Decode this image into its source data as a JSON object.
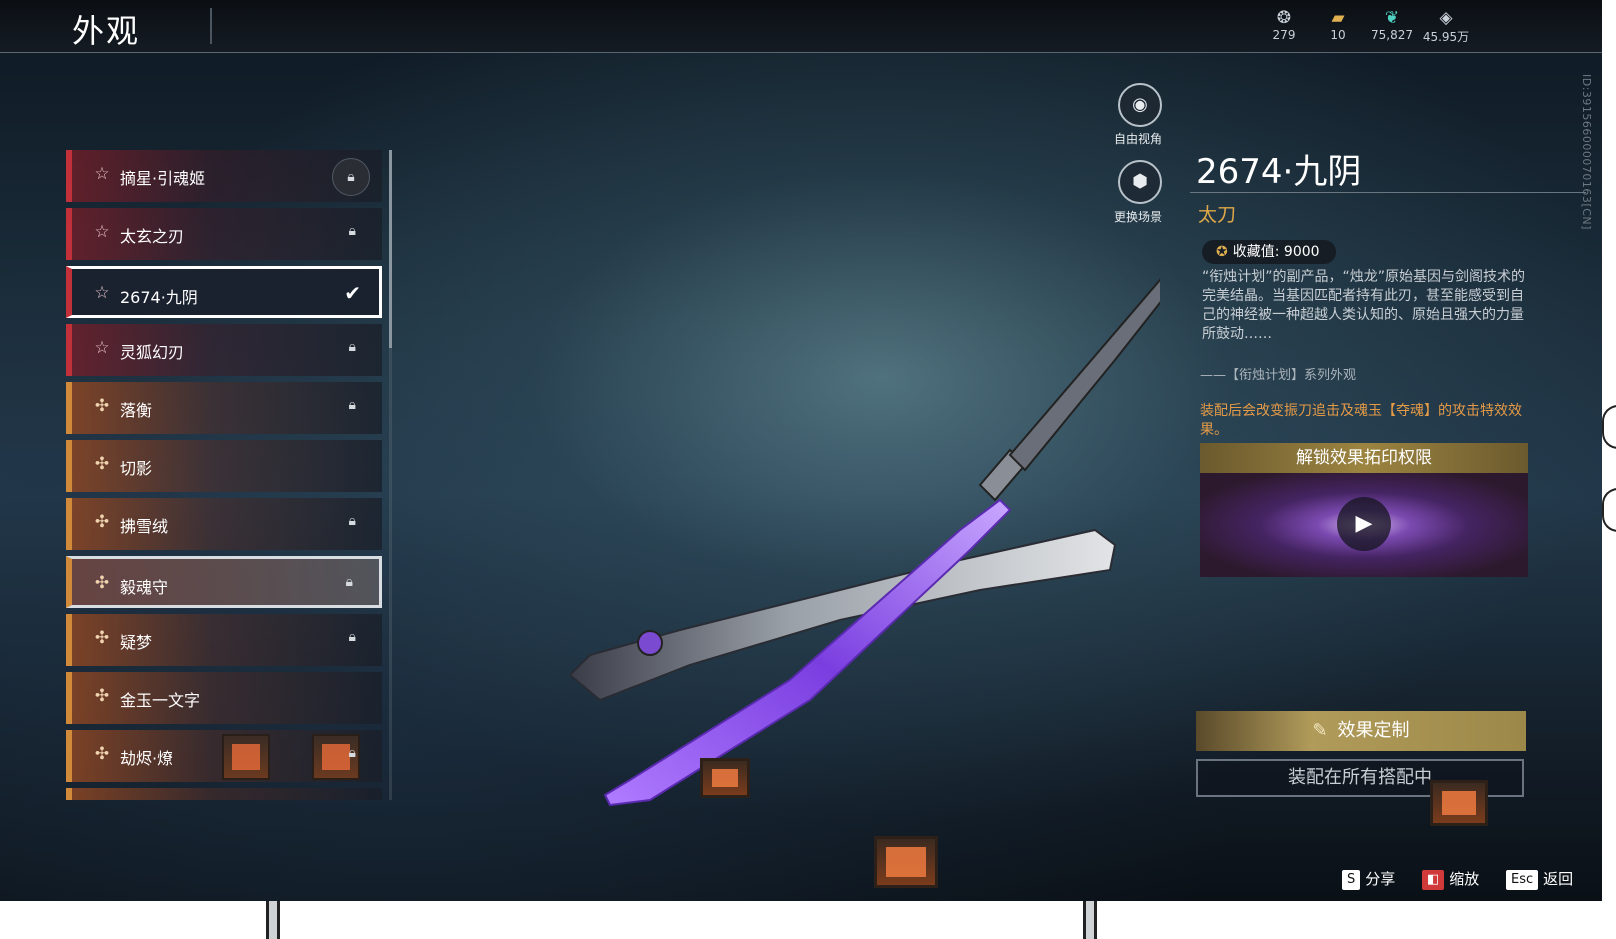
{
  "header": {
    "title": "外观",
    "currencies": [
      {
        "icon": "sprite-icon",
        "value": "279"
      },
      {
        "icon": "ticket-icon",
        "value": "10"
      },
      {
        "icon": "feather-icon",
        "value": "75,827"
      },
      {
        "icon": "diamond-icon",
        "value": "45.95万"
      }
    ]
  },
  "uid": "ID:391566000070163[CN]",
  "list": {
    "items": [
      {
        "name": "摘星·引魂姬",
        "rarity": "red",
        "status": "locked"
      },
      {
        "name": "太玄之刃",
        "rarity": "red",
        "status": "locked"
      },
      {
        "name": "2674·九阴",
        "rarity": "red",
        "status": "equipped"
      },
      {
        "name": "灵狐幻刃",
        "rarity": "red",
        "status": "locked"
      },
      {
        "name": "落衡",
        "rarity": "orange",
        "status": "locked"
      },
      {
        "name": "切影",
        "rarity": "orange",
        "status": "none"
      },
      {
        "name": "拂雪绒",
        "rarity": "orange",
        "status": "locked"
      },
      {
        "name": "毅魂守",
        "rarity": "orange",
        "status": "locked"
      },
      {
        "name": "疑梦",
        "rarity": "orange",
        "status": "locked"
      },
      {
        "name": "金玉一文字",
        "rarity": "orange",
        "status": "none"
      },
      {
        "name": "劫烬·燎",
        "rarity": "orange",
        "status": "locked"
      }
    ]
  },
  "side_buttons": {
    "free_view": "自由视角",
    "change_scene": "更换场景"
  },
  "detail": {
    "name": "2674·九阴",
    "type": "太刀",
    "collection_label": "收藏值:",
    "collection_value": "9000",
    "description": "“衔烛计划”的副产品，“烛龙”原始基因与剑阁技术的完美结晶。当基因匹配者持有此刃，甚至能感受到自己的神经被一种超越人类认知的、原始且强大的力量所鼓动……",
    "series": "——【衔烛计划】系列外观",
    "effect": "装配后会改变振刀追击及魂玉【夺魂】的攻击特效效果。",
    "unlock_title": "解锁效果拓印权限",
    "customize_button": "效果定制",
    "equip_button": "装配在所有搭配中"
  },
  "hints": {
    "share_key": "S",
    "share": "分享",
    "zoom": "缩放",
    "back_key": "Esc",
    "back": "返回"
  },
  "colors": {
    "accent_gold": "#e0a848",
    "effect_orange": "#e59a46",
    "rarity_red": "#c2303a",
    "rarity_orange": "#d08a3a"
  }
}
